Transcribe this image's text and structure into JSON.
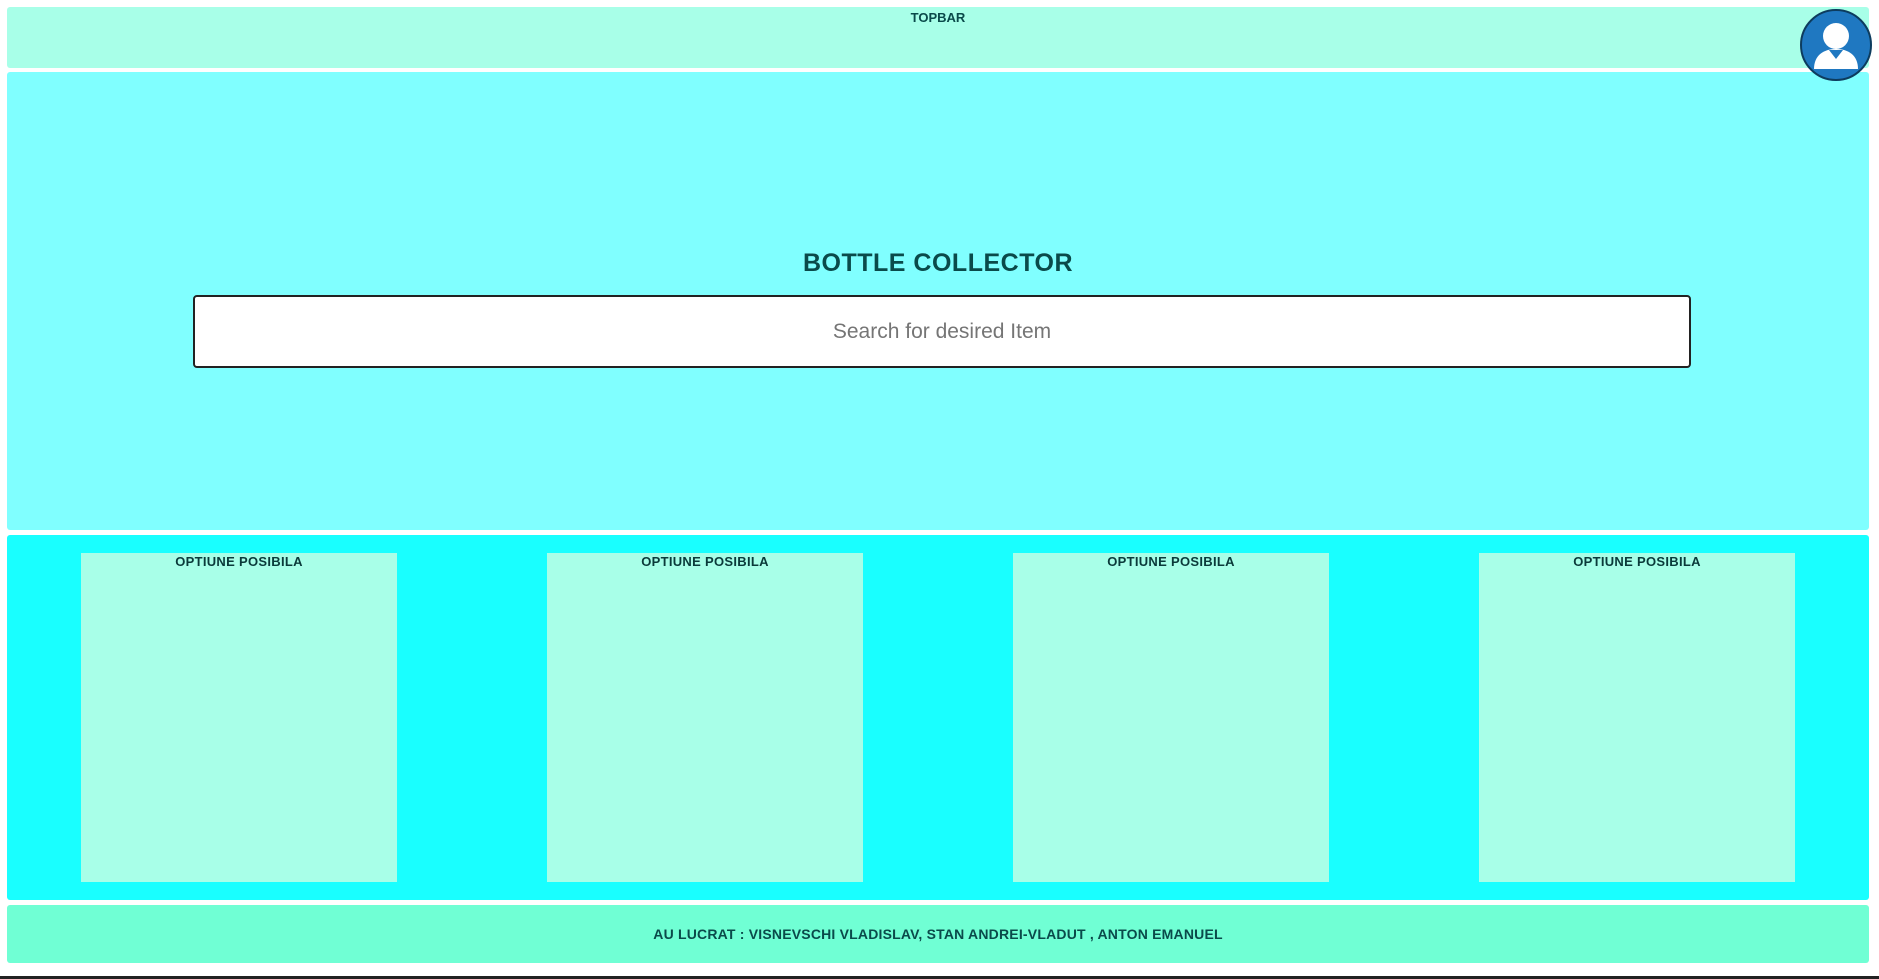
{
  "topbar": {
    "title": "TOPBAR",
    "avatar_icon": "user-avatar-icon"
  },
  "hero": {
    "title": "BOTTLE COLLECTOR",
    "search": {
      "placeholder": "Search for desired Item",
      "value": ""
    }
  },
  "options": {
    "cards": [
      {
        "title": "OPTIUNE POSIBILA"
      },
      {
        "title": "OPTIUNE POSIBILA"
      },
      {
        "title": "OPTIUNE POSIBILA"
      },
      {
        "title": "OPTIUNE POSIBILA"
      }
    ]
  },
  "footer": {
    "text": "AU LUCRAT : VISNEVSCHI VLADISLAV, STAN ANDREI-VLADUT , ANTON EMANUEL"
  },
  "colors": {
    "topbar_bg": "#a8ffe8",
    "hero_bg": "#80ffff",
    "options_bg": "#19ffff",
    "card_bg": "#a8ffe8",
    "footer_bg": "#70ffd4",
    "avatar_bg": "#1f78c1"
  }
}
